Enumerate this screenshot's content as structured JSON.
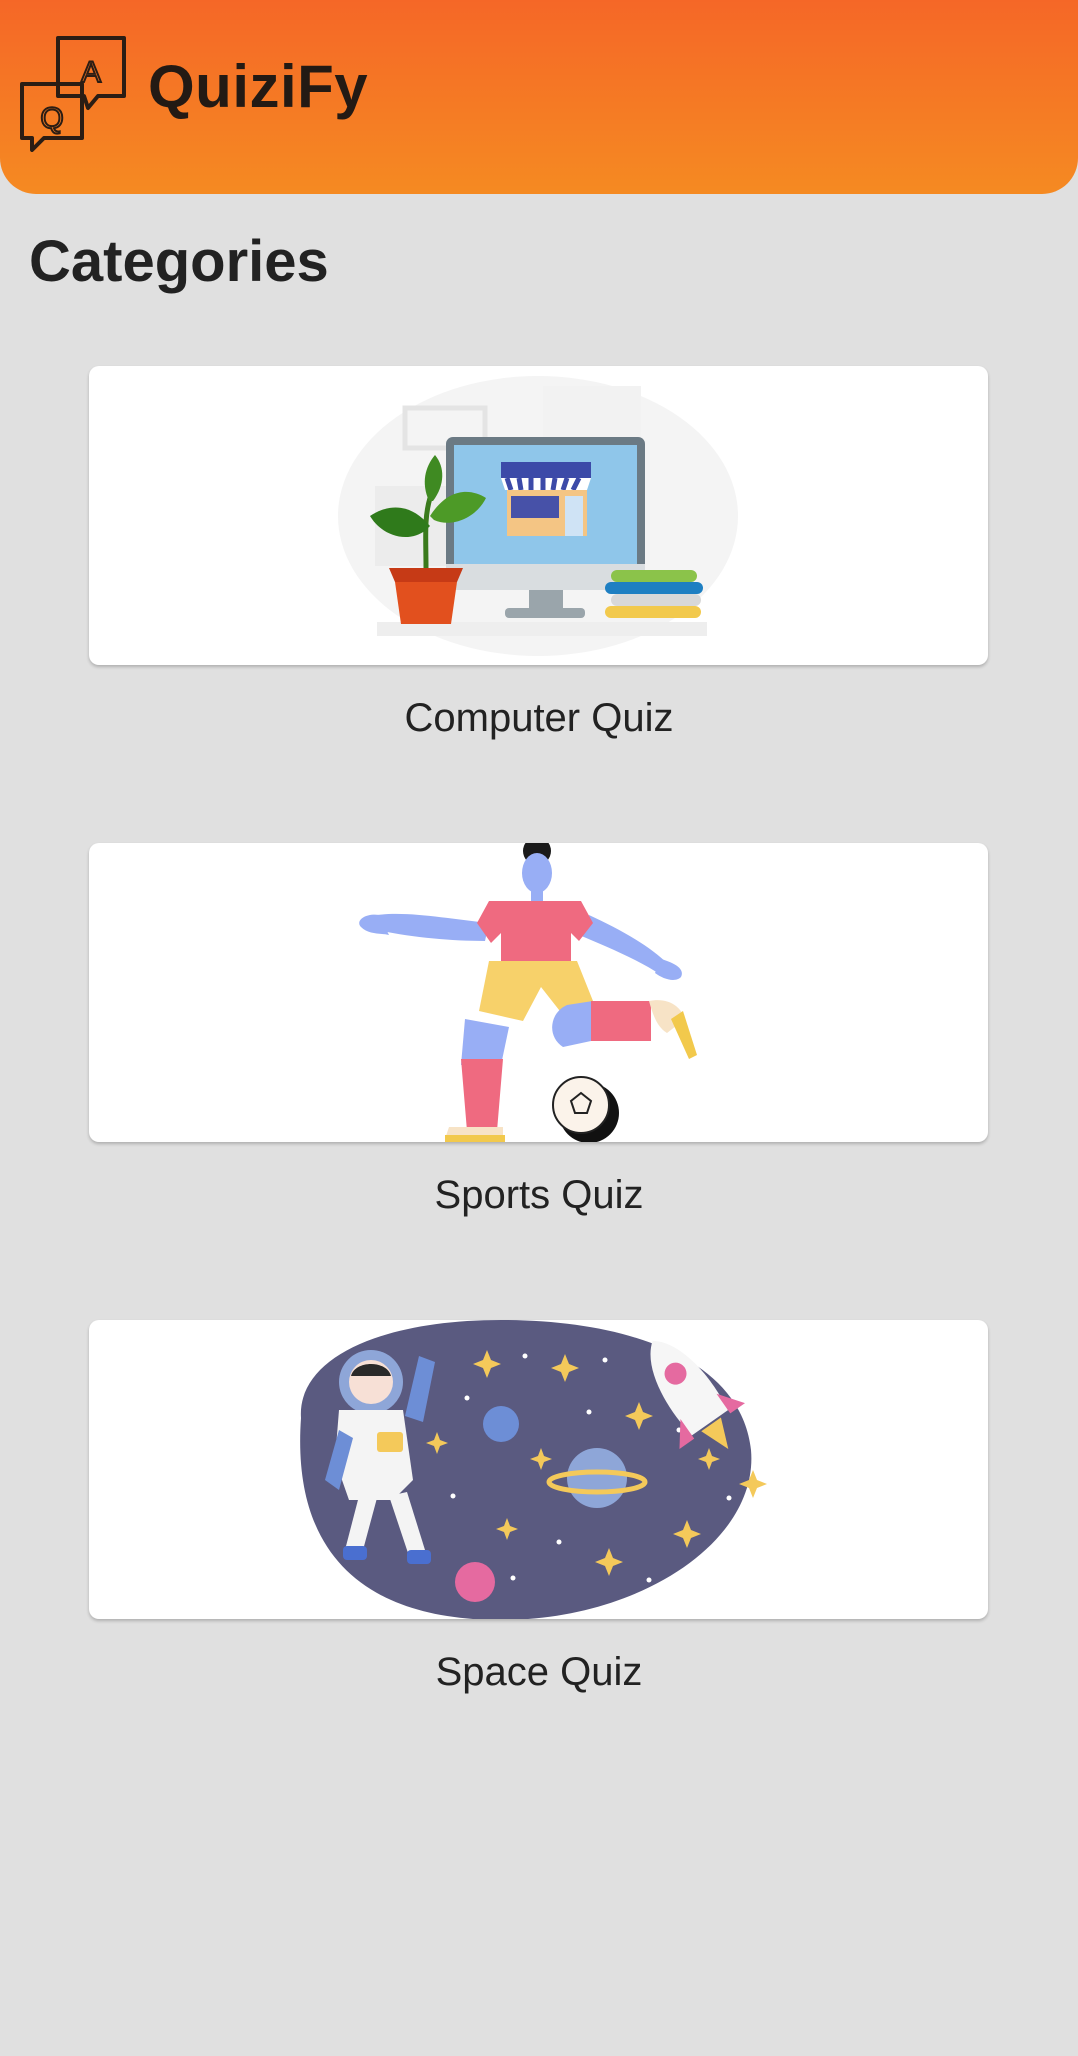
{
  "header": {
    "title": "QuiziFy",
    "logo_icon": "chat-bubbles-qa-icon",
    "logo_letters": [
      "A",
      "Q"
    ],
    "gradient": [
      "#f56727",
      "#f58a22"
    ]
  },
  "main": {
    "section_title": "Categories",
    "categories": [
      {
        "label": "Computer Quiz",
        "illustration": "computer-desk-illustration"
      },
      {
        "label": "Sports Quiz",
        "illustration": "soccer-player-illustration"
      },
      {
        "label": "Space Quiz",
        "illustration": "astronaut-space-illustration"
      }
    ]
  },
  "colors": {
    "background": "#e0e0e0",
    "card": "#ffffff",
    "text": "#222222"
  }
}
